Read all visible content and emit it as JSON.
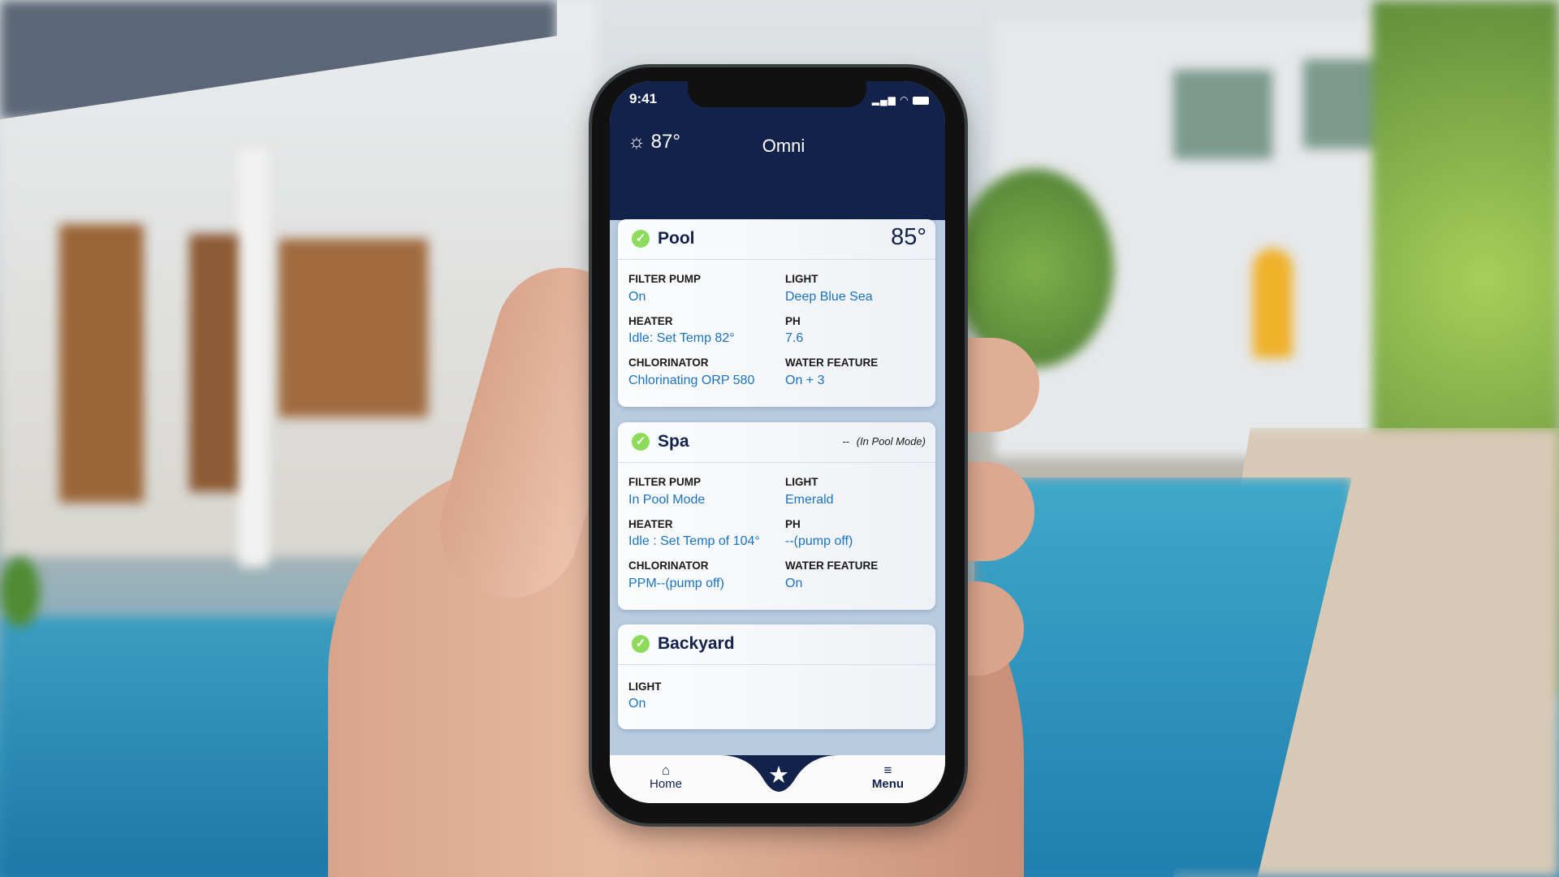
{
  "status_bar": {
    "time": "9:41"
  },
  "header": {
    "weather_icon": "sun-icon",
    "temperature": "87°",
    "title": "Omni"
  },
  "cards": [
    {
      "title": "Pool",
      "status_icon": "check-circle-icon",
      "header_value": "85°",
      "items": [
        {
          "label": "FILTER PUMP",
          "value": "On"
        },
        {
          "label": "LIGHT",
          "value": "Deep Blue Sea"
        },
        {
          "label": "HEATER",
          "value": "Idle: Set Temp 82°"
        },
        {
          "label": "PH",
          "value": "7.6"
        },
        {
          "label": "CHLORINATOR",
          "value": "Chlorinating ORP 580"
        },
        {
          "label": "WATER FEATURE",
          "value": "On + 3"
        }
      ]
    },
    {
      "title": "Spa",
      "status_icon": "check-circle-icon",
      "header_value": "--",
      "header_note": "(In Pool Mode)",
      "items": [
        {
          "label": "FILTER PUMP",
          "value": "In Pool Mode"
        },
        {
          "label": "LIGHT",
          "value": "Emerald"
        },
        {
          "label": "HEATER",
          "value": "Idle : Set Temp of 104°"
        },
        {
          "label": "PH",
          "value": "--(pump off)"
        },
        {
          "label": "CHLORINATOR",
          "value": "PPM--(pump off)"
        },
        {
          "label": "WATER FEATURE",
          "value": "On"
        }
      ]
    },
    {
      "title": "Backyard",
      "status_icon": "check-circle-icon",
      "items": [
        {
          "label": "LIGHT",
          "value": "On"
        }
      ]
    }
  ],
  "nav": {
    "home": "Home",
    "favorites_icon": "star-icon",
    "menu": "Menu"
  },
  "colors": {
    "navy": "#13224a",
    "accent_blue": "#1a73c0",
    "status_green": "#8ddb5a",
    "background": "#b8cbe0"
  }
}
